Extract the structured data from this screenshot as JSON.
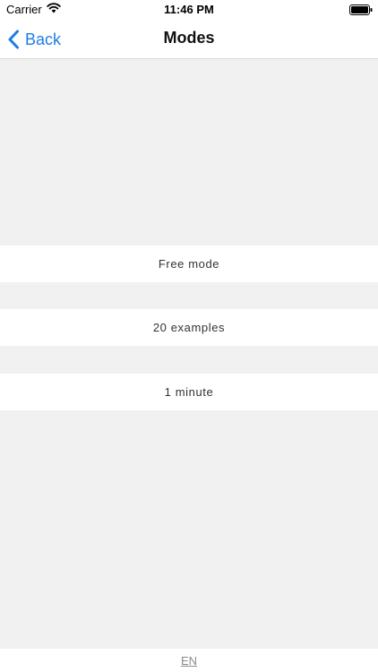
{
  "status_bar": {
    "carrier": "Carrier",
    "time": "11:46 PM",
    "wifi_icon": "wifi-icon",
    "battery_icon": "battery-icon"
  },
  "nav": {
    "back_label": "Back",
    "back_icon": "chevron-left-icon",
    "title": "Modes"
  },
  "modes": [
    {
      "label": "Free mode"
    },
    {
      "label": "20 examples"
    },
    {
      "label": "1 minute"
    }
  ],
  "footer": {
    "language": "EN"
  },
  "colors": {
    "accent": "#1d7ce8",
    "background": "#f1f1f1",
    "row_background": "#ffffff",
    "footer_text": "#8a8a8a"
  }
}
